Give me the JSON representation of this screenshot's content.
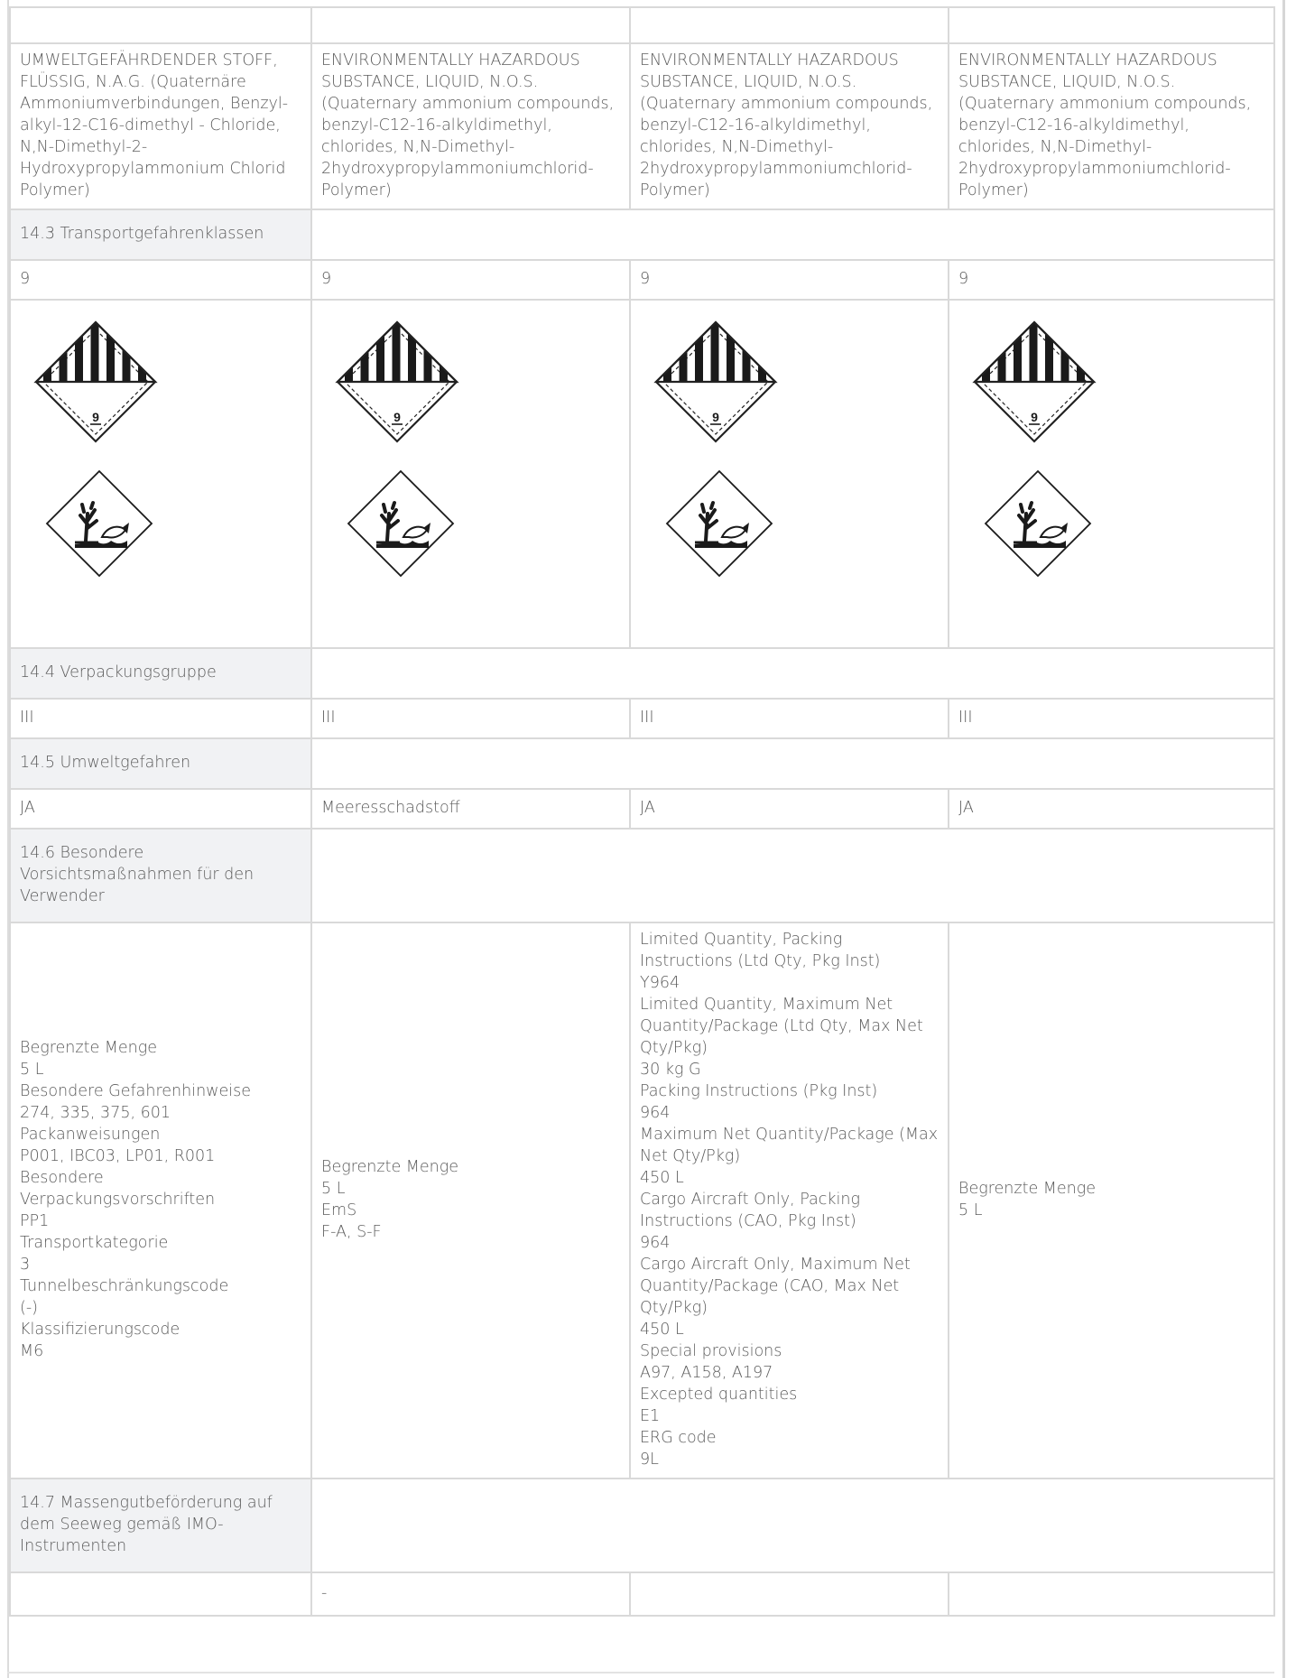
{
  "shipping_names": [
    "UMWELTGEFÄHRDENDER STOFF, FLÜSSIG, N.A.G. (Quaternäre Ammoniumverbindungen, Benzyl-alkyl-12-C16-dimethyl - Chloride, N,N-Dimethyl-2-Hydroxypropylammonium Chlorid Polymer)",
    "ENVIRONMENTALLY HAZARDOUS SUBSTANCE, LIQUID, N.O.S. (Quaternary ammonium compounds, benzyl-C12-16-alkyldimethyl, chlorides, N,N-Dimethyl-2hydroxypropylammoniumchlorid-Polymer)",
    "ENVIRONMENTALLY HAZARDOUS SUBSTANCE, LIQUID, N.O.S. (Quaternary ammonium compounds, benzyl-C12-16-alkyldimethyl, chlorides, N,N-Dimethyl-2hydroxypropylammoniumchlorid-Polymer)",
    "ENVIRONMENTALLY HAZARDOUS SUBSTANCE, LIQUID, N.O.S. (Quaternary ammonium compounds, benzyl-C12-16-alkyldimethyl, chlorides, N,N-Dimethyl-2hydroxypropylammoniumchlorid-Polymer)"
  ],
  "s14_3": {
    "heading": "14.3 Transportgefahrenklassen",
    "values": [
      "9",
      "9",
      "9",
      "9"
    ],
    "label_class_number": "9",
    "pictogram_icons": [
      "class-9-hazard-label-icon",
      "environment-hazard-pictogram-icon"
    ]
  },
  "s14_4": {
    "heading": "14.4 Verpackungsgruppe",
    "values": [
      "III",
      "III",
      "III",
      "III"
    ]
  },
  "s14_5": {
    "heading": "14.5 Umweltgefahren",
    "values": [
      "JA",
      "Meeresschadstoff",
      "JA",
      "JA"
    ]
  },
  "s14_6": {
    "heading": "14.6 Besondere Vorsichtsmaßnahmen für den Verwender",
    "columns": [
      [
        "Begrenzte Menge",
        "5 L",
        "Besondere Gefahrenhinweise",
        "274, 335, 375, 601",
        "Packanweisungen",
        "P001, IBC03, LP01, R001",
        "Besondere Verpackungsvorschriften",
        "PP1",
        "Transportkategorie",
        "3",
        "Tunnelbeschränkungscode",
        "(-)",
        "Klassifizierungscode",
        "M6"
      ],
      [
        "Begrenzte Menge",
        "5 L",
        "EmS",
        "F-A, S-F"
      ],
      [
        "Limited Quantity, Packing Instructions (Ltd Qty, Pkg Inst)",
        "Y964",
        "Limited Quantity, Maximum Net Quantity/Package (Ltd Qty, Max Net Qty/Pkg)",
        "30 kg G",
        "Packing Instructions (Pkg Inst)",
        "964",
        "Maximum Net Quantity/Package (Max Net Qty/Pkg)",
        "450 L",
        "Cargo Aircraft Only, Packing Instructions (CAO, Pkg Inst)",
        "964",
        "Cargo Aircraft Only, Maximum Net Quantity/Package (CAO, Max Net Qty/Pkg)",
        "450 L",
        "Special provisions",
        "A97, A158, A197",
        "Excepted quantities",
        "E1",
        "ERG code",
        "9L"
      ],
      [
        "Begrenzte Menge",
        "5 L"
      ]
    ]
  },
  "s14_7": {
    "heading": "14.7 Massengutbeförderung auf dem Seeweg gemäß IMO-Instrumenten",
    "values": [
      "",
      "-",
      "",
      ""
    ]
  }
}
